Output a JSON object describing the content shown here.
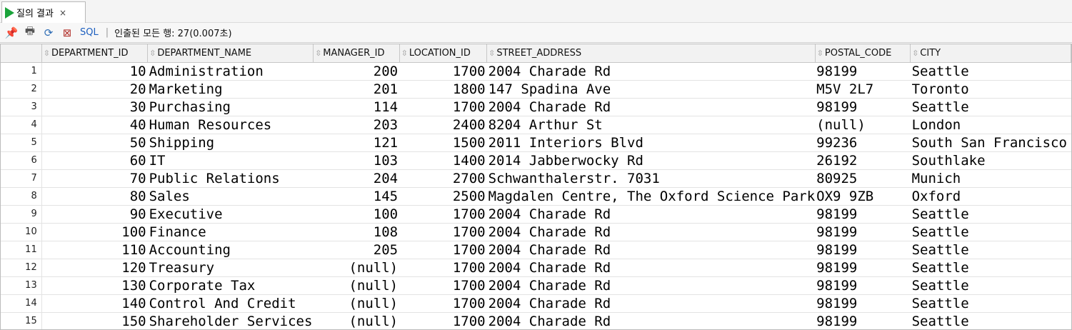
{
  "tab": {
    "label": "질의 결과",
    "close": "×"
  },
  "toolbar": {
    "sql_label": "SQL",
    "separator": "|",
    "fetch_status": "인출된 모든 행: 27(0.007초)"
  },
  "grid": {
    "columns": [
      "DEPARTMENT_ID",
      "DEPARTMENT_NAME",
      "MANAGER_ID",
      "LOCATION_ID",
      "STREET_ADDRESS",
      "POSTAL_CODE",
      "CITY"
    ],
    "rows": [
      [
        "1",
        "10",
        "Administration",
        "200",
        "1700",
        "2004 Charade Rd",
        "98199",
        "Seattle"
      ],
      [
        "2",
        "20",
        "Marketing",
        "201",
        "1800",
        "147 Spadina Ave",
        "M5V 2L7",
        "Toronto"
      ],
      [
        "3",
        "30",
        "Purchasing",
        "114",
        "1700",
        "2004 Charade Rd",
        "98199",
        "Seattle"
      ],
      [
        "4",
        "40",
        "Human Resources",
        "203",
        "2400",
        "8204 Arthur St",
        "(null)",
        "London"
      ],
      [
        "5",
        "50",
        "Shipping",
        "121",
        "1500",
        "2011 Interiors Blvd",
        "99236",
        "South San Francisco"
      ],
      [
        "6",
        "60",
        "IT",
        "103",
        "1400",
        "2014 Jabberwocky Rd",
        "26192",
        "Southlake"
      ],
      [
        "7",
        "70",
        "Public Relations",
        "204",
        "2700",
        "Schwanthalerstr. 7031",
        "80925",
        "Munich"
      ],
      [
        "8",
        "80",
        "Sales",
        "145",
        "2500",
        "Magdalen Centre, The Oxford Science Park",
        "OX9 9ZB",
        "Oxford"
      ],
      [
        "9",
        "90",
        "Executive",
        "100",
        "1700",
        "2004 Charade Rd",
        "98199",
        "Seattle"
      ],
      [
        "10",
        "100",
        "Finance",
        "108",
        "1700",
        "2004 Charade Rd",
        "98199",
        "Seattle"
      ],
      [
        "11",
        "110",
        "Accounting",
        "205",
        "1700",
        "2004 Charade Rd",
        "98199",
        "Seattle"
      ],
      [
        "12",
        "120",
        "Treasury",
        "(null)",
        "1700",
        "2004 Charade Rd",
        "98199",
        "Seattle"
      ],
      [
        "13",
        "130",
        "Corporate Tax",
        "(null)",
        "1700",
        "2004 Charade Rd",
        "98199",
        "Seattle"
      ],
      [
        "14",
        "140",
        "Control And Credit",
        "(null)",
        "1700",
        "2004 Charade Rd",
        "98199",
        "Seattle"
      ],
      [
        "15",
        "150",
        "Shareholder Services",
        "(null)",
        "1700",
        "2004 Charade Rd",
        "98199",
        "Seattle"
      ]
    ]
  },
  "icons": [
    "pin-icon",
    "print-icon",
    "refresh-icon",
    "export-icon",
    "sort-icon"
  ]
}
